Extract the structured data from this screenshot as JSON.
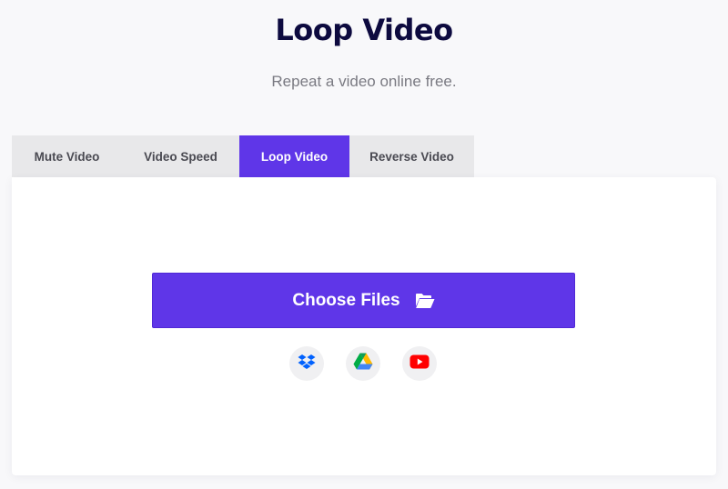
{
  "header": {
    "title": "Loop Video",
    "subtitle": "Repeat a video online free."
  },
  "tabs": [
    {
      "label": "Mute Video",
      "active": false
    },
    {
      "label": "Video Speed",
      "active": false
    },
    {
      "label": "Loop Video",
      "active": true
    },
    {
      "label": "Reverse Video",
      "active": false
    }
  ],
  "upload": {
    "button_label": "Choose Files",
    "button_icon": "folder-open-icon",
    "sources": [
      {
        "name": "dropbox",
        "icon": "dropbox-icon"
      },
      {
        "name": "google-drive",
        "icon": "google-drive-icon"
      },
      {
        "name": "youtube",
        "icon": "youtube-icon"
      }
    ]
  },
  "colors": {
    "accent": "#5f36e8",
    "title": "#0d0a3f",
    "subtitle": "#7a7a82",
    "tab_inactive_bg": "#e8e8ea",
    "page_bg": "#f8f8fa"
  }
}
